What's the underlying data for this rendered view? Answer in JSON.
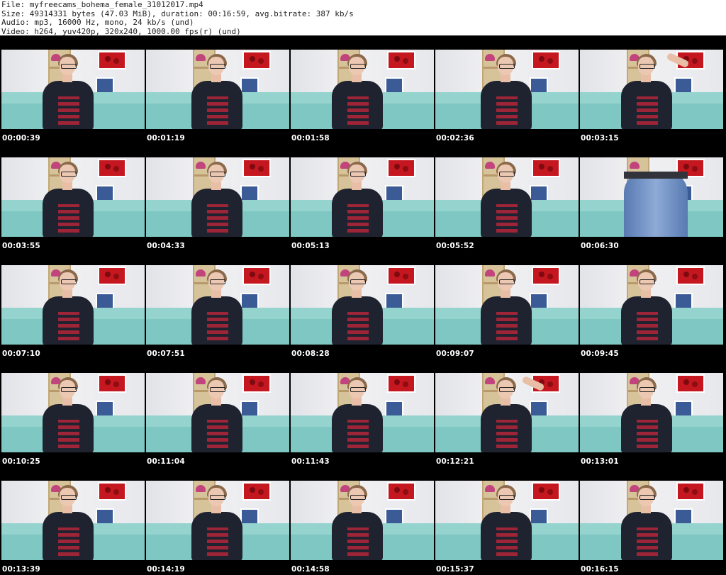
{
  "header": {
    "file": "File: myfreecams_bohema_female_31012017.mp4",
    "size": "Size: 49314331 bytes (47.03 MiB), duration: 00:16:59, avg.bitrate: 387 kb/s",
    "audio": "Audio: mp3, 16000 Hz, mono, 24 kb/s (und)",
    "video": "Video: h264, yuv420p, 320x240, 1000.00 fps(r) (und)"
  },
  "thumbnails": [
    {
      "time": "00:00:39",
      "pose": "sit"
    },
    {
      "time": "00:01:19",
      "pose": "sit"
    },
    {
      "time": "00:01:58",
      "pose": "sit"
    },
    {
      "time": "00:02:36",
      "pose": "sit"
    },
    {
      "time": "00:03:15",
      "pose": "arm"
    },
    {
      "time": "00:03:55",
      "pose": "sit"
    },
    {
      "time": "00:04:33",
      "pose": "sit"
    },
    {
      "time": "00:05:13",
      "pose": "sit"
    },
    {
      "time": "00:05:52",
      "pose": "sit"
    },
    {
      "time": "00:06:30",
      "pose": "jeans"
    },
    {
      "time": "00:07:10",
      "pose": "sit"
    },
    {
      "time": "00:07:51",
      "pose": "sit"
    },
    {
      "time": "00:08:28",
      "pose": "sit"
    },
    {
      "time": "00:09:07",
      "pose": "sit"
    },
    {
      "time": "00:09:45",
      "pose": "sit"
    },
    {
      "time": "00:10:25",
      "pose": "sit"
    },
    {
      "time": "00:11:04",
      "pose": "sit"
    },
    {
      "time": "00:11:43",
      "pose": "sit"
    },
    {
      "time": "00:12:21",
      "pose": "arm"
    },
    {
      "time": "00:13:01",
      "pose": "sit"
    },
    {
      "time": "00:13:39",
      "pose": "sit"
    },
    {
      "time": "00:14:19",
      "pose": "sit"
    },
    {
      "time": "00:14:58",
      "pose": "sit"
    },
    {
      "time": "00:15:37",
      "pose": "sit"
    },
    {
      "time": "00:16:15",
      "pose": "sit"
    }
  ]
}
